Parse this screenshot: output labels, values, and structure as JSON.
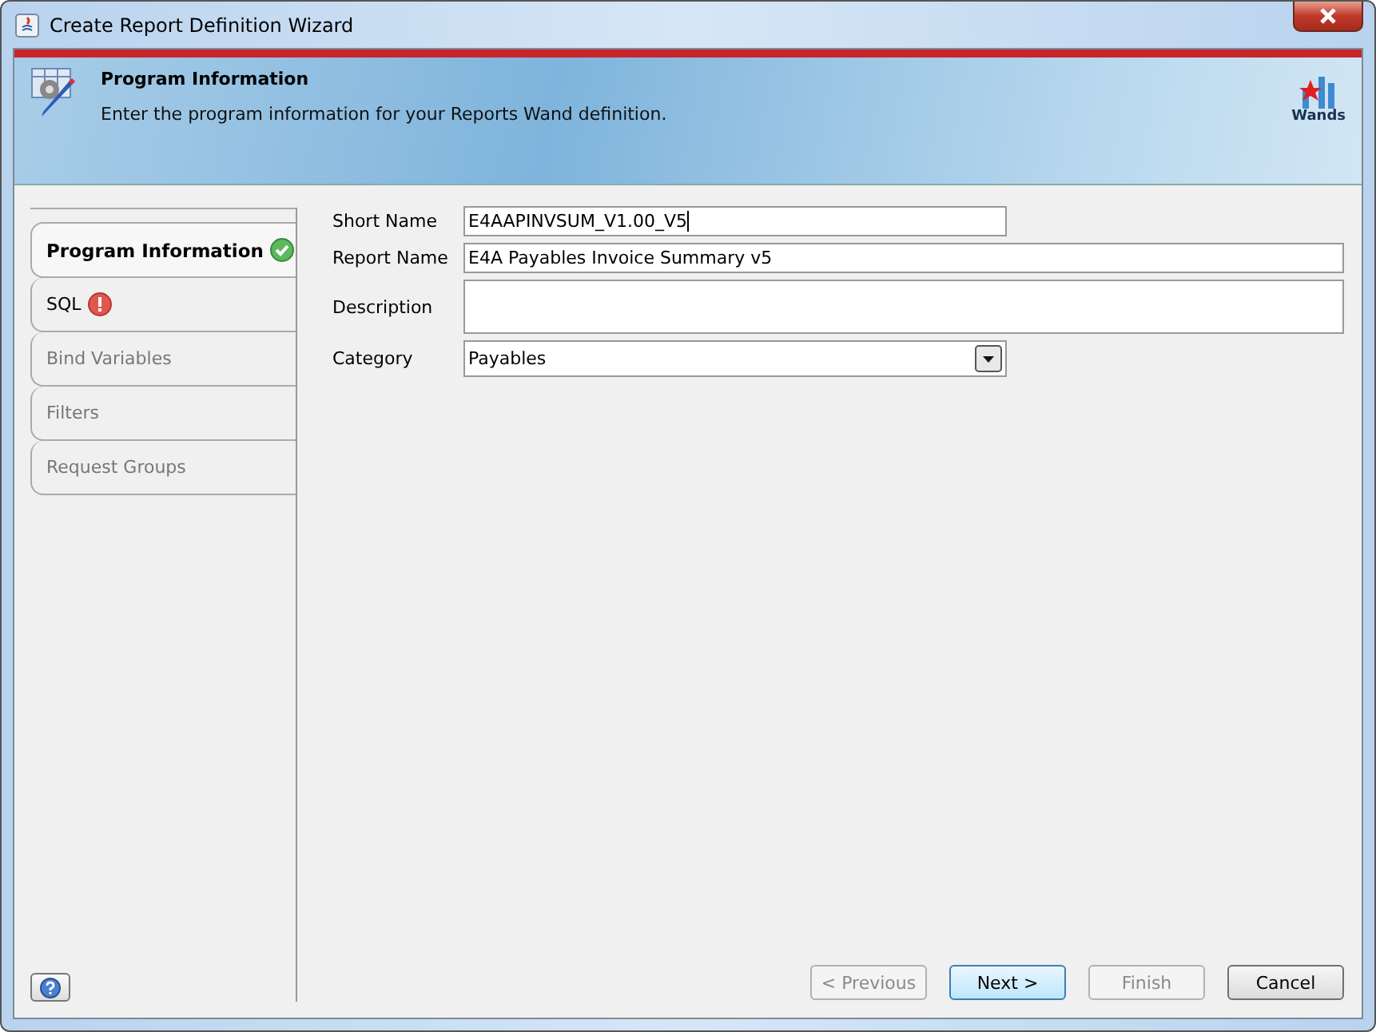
{
  "window": {
    "title": "Create Report Definition Wizard"
  },
  "header": {
    "title": "Program Information",
    "subtitle": "Enter the program information for your Reports Wand definition.",
    "logo_text": "Wands"
  },
  "steps": [
    {
      "label": "Program Information",
      "selected": true,
      "disabled": false,
      "kind": "ok"
    },
    {
      "label": "SQL",
      "selected": false,
      "disabled": false,
      "kind": "error"
    },
    {
      "label": "Bind Variables",
      "selected": false,
      "disabled": true,
      "kind": "plain"
    },
    {
      "label": "Filters",
      "selected": false,
      "disabled": true,
      "kind": "plain"
    },
    {
      "label": "Request Groups",
      "selected": false,
      "disabled": true,
      "kind": "plain"
    }
  ],
  "fields": [
    {
      "label": "Short Name",
      "kind": "short-text",
      "value": "E4AAPINVSUM_V1.00_V5",
      "focused": true
    },
    {
      "label": "Report Name",
      "kind": "text",
      "value": "E4A Payables Invoice Summary v5",
      "focused": false
    },
    {
      "label": "Description",
      "kind": "textarea",
      "focused": false
    },
    {
      "label": "Category",
      "kind": "select",
      "value": "Payables",
      "focused": false
    }
  ],
  "buttons": [
    {
      "label": "< Previous",
      "disabled": true,
      "default": false
    },
    {
      "label": "Next >",
      "disabled": false,
      "default": true
    },
    {
      "label": "Finish",
      "disabled": true,
      "default": false
    },
    {
      "label": "Cancel",
      "disabled": false,
      "default": false
    }
  ]
}
